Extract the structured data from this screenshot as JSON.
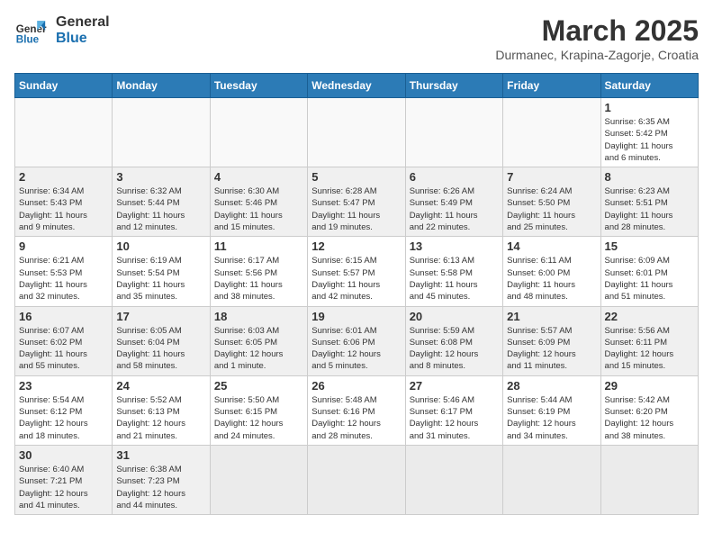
{
  "header": {
    "logo_general": "General",
    "logo_blue": "Blue",
    "month_title": "March 2025",
    "location": "Durmanec, Krapina-Zagorje, Croatia"
  },
  "weekdays": [
    "Sunday",
    "Monday",
    "Tuesday",
    "Wednesday",
    "Thursday",
    "Friday",
    "Saturday"
  ],
  "weeks": [
    [
      {
        "day": "",
        "info": ""
      },
      {
        "day": "",
        "info": ""
      },
      {
        "day": "",
        "info": ""
      },
      {
        "day": "",
        "info": ""
      },
      {
        "day": "",
        "info": ""
      },
      {
        "day": "",
        "info": ""
      },
      {
        "day": "1",
        "info": "Sunrise: 6:35 AM\nSunset: 5:42 PM\nDaylight: 11 hours\nand 6 minutes."
      }
    ],
    [
      {
        "day": "2",
        "info": "Sunrise: 6:34 AM\nSunset: 5:43 PM\nDaylight: 11 hours\nand 9 minutes."
      },
      {
        "day": "3",
        "info": "Sunrise: 6:32 AM\nSunset: 5:44 PM\nDaylight: 11 hours\nand 12 minutes."
      },
      {
        "day": "4",
        "info": "Sunrise: 6:30 AM\nSunset: 5:46 PM\nDaylight: 11 hours\nand 15 minutes."
      },
      {
        "day": "5",
        "info": "Sunrise: 6:28 AM\nSunset: 5:47 PM\nDaylight: 11 hours\nand 19 minutes."
      },
      {
        "day": "6",
        "info": "Sunrise: 6:26 AM\nSunset: 5:49 PM\nDaylight: 11 hours\nand 22 minutes."
      },
      {
        "day": "7",
        "info": "Sunrise: 6:24 AM\nSunset: 5:50 PM\nDaylight: 11 hours\nand 25 minutes."
      },
      {
        "day": "8",
        "info": "Sunrise: 6:23 AM\nSunset: 5:51 PM\nDaylight: 11 hours\nand 28 minutes."
      }
    ],
    [
      {
        "day": "9",
        "info": "Sunrise: 6:21 AM\nSunset: 5:53 PM\nDaylight: 11 hours\nand 32 minutes."
      },
      {
        "day": "10",
        "info": "Sunrise: 6:19 AM\nSunset: 5:54 PM\nDaylight: 11 hours\nand 35 minutes."
      },
      {
        "day": "11",
        "info": "Sunrise: 6:17 AM\nSunset: 5:56 PM\nDaylight: 11 hours\nand 38 minutes."
      },
      {
        "day": "12",
        "info": "Sunrise: 6:15 AM\nSunset: 5:57 PM\nDaylight: 11 hours\nand 42 minutes."
      },
      {
        "day": "13",
        "info": "Sunrise: 6:13 AM\nSunset: 5:58 PM\nDaylight: 11 hours\nand 45 minutes."
      },
      {
        "day": "14",
        "info": "Sunrise: 6:11 AM\nSunset: 6:00 PM\nDaylight: 11 hours\nand 48 minutes."
      },
      {
        "day": "15",
        "info": "Sunrise: 6:09 AM\nSunset: 6:01 PM\nDaylight: 11 hours\nand 51 minutes."
      }
    ],
    [
      {
        "day": "16",
        "info": "Sunrise: 6:07 AM\nSunset: 6:02 PM\nDaylight: 11 hours\nand 55 minutes."
      },
      {
        "day": "17",
        "info": "Sunrise: 6:05 AM\nSunset: 6:04 PM\nDaylight: 11 hours\nand 58 minutes."
      },
      {
        "day": "18",
        "info": "Sunrise: 6:03 AM\nSunset: 6:05 PM\nDaylight: 12 hours\nand 1 minute."
      },
      {
        "day": "19",
        "info": "Sunrise: 6:01 AM\nSunset: 6:06 PM\nDaylight: 12 hours\nand 5 minutes."
      },
      {
        "day": "20",
        "info": "Sunrise: 5:59 AM\nSunset: 6:08 PM\nDaylight: 12 hours\nand 8 minutes."
      },
      {
        "day": "21",
        "info": "Sunrise: 5:57 AM\nSunset: 6:09 PM\nDaylight: 12 hours\nand 11 minutes."
      },
      {
        "day": "22",
        "info": "Sunrise: 5:56 AM\nSunset: 6:11 PM\nDaylight: 12 hours\nand 15 minutes."
      }
    ],
    [
      {
        "day": "23",
        "info": "Sunrise: 5:54 AM\nSunset: 6:12 PM\nDaylight: 12 hours\nand 18 minutes."
      },
      {
        "day": "24",
        "info": "Sunrise: 5:52 AM\nSunset: 6:13 PM\nDaylight: 12 hours\nand 21 minutes."
      },
      {
        "day": "25",
        "info": "Sunrise: 5:50 AM\nSunset: 6:15 PM\nDaylight: 12 hours\nand 24 minutes."
      },
      {
        "day": "26",
        "info": "Sunrise: 5:48 AM\nSunset: 6:16 PM\nDaylight: 12 hours\nand 28 minutes."
      },
      {
        "day": "27",
        "info": "Sunrise: 5:46 AM\nSunset: 6:17 PM\nDaylight: 12 hours\nand 31 minutes."
      },
      {
        "day": "28",
        "info": "Sunrise: 5:44 AM\nSunset: 6:19 PM\nDaylight: 12 hours\nand 34 minutes."
      },
      {
        "day": "29",
        "info": "Sunrise: 5:42 AM\nSunset: 6:20 PM\nDaylight: 12 hours\nand 38 minutes."
      }
    ],
    [
      {
        "day": "30",
        "info": "Sunrise: 6:40 AM\nSunset: 7:21 PM\nDaylight: 12 hours\nand 41 minutes."
      },
      {
        "day": "31",
        "info": "Sunrise: 6:38 AM\nSunset: 7:23 PM\nDaylight: 12 hours\nand 44 minutes."
      },
      {
        "day": "",
        "info": ""
      },
      {
        "day": "",
        "info": ""
      },
      {
        "day": "",
        "info": ""
      },
      {
        "day": "",
        "info": ""
      },
      {
        "day": "",
        "info": ""
      }
    ]
  ]
}
